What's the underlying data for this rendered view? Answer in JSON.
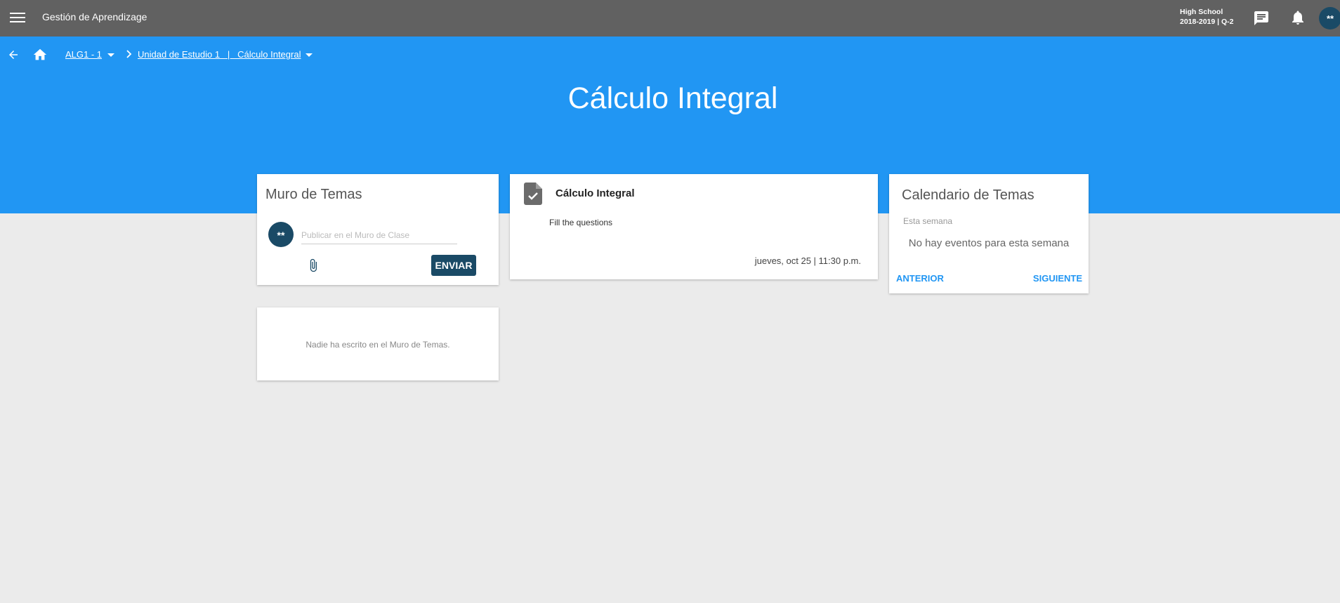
{
  "topbar": {
    "menu_icon": "hamburger-menu-icon",
    "app_title": "Gestión de Aprendizage",
    "school_name": "High School",
    "school_term": "2018-2019 | Q-2",
    "chat_icon": "chat-icon",
    "bell_icon": "bell-icon",
    "avatar_text": "**"
  },
  "hero": {
    "back_icon": "arrow-back-icon",
    "home_icon": "home-icon",
    "breadcrumb": [
      {
        "label": "ALG1 - 1"
      },
      {
        "label": "Unidad de Estudio 1   |   Cálculo Integral"
      }
    ],
    "title": "Cálculo Integral"
  },
  "wall": {
    "title": "Muro de Temas",
    "avatar_text": "**",
    "input_placeholder": "Publicar en el Muro de Clase",
    "attach_icon": "paperclip-icon",
    "send_label": "ENVIAR",
    "empty_message": "Nadie ha escrito en el Muro de Temas."
  },
  "task": {
    "icon": "assignment-file-icon",
    "title": "Cálculo Integral",
    "description": "Fill the questions",
    "due": "jueves, oct 25 | 11:30 p.m."
  },
  "calendar": {
    "title": "Calendario de Temas",
    "week_label": "Esta semana",
    "empty_message": "No hay eventos para esta semana",
    "prev_label": "ANTERIOR",
    "next_label": "SIGUIENTE"
  },
  "colors": {
    "topbar": "#616161",
    "hero": "#2196f3",
    "background": "#ebebeb",
    "avatar": "#1a4a66",
    "accent": "#2196f3"
  }
}
